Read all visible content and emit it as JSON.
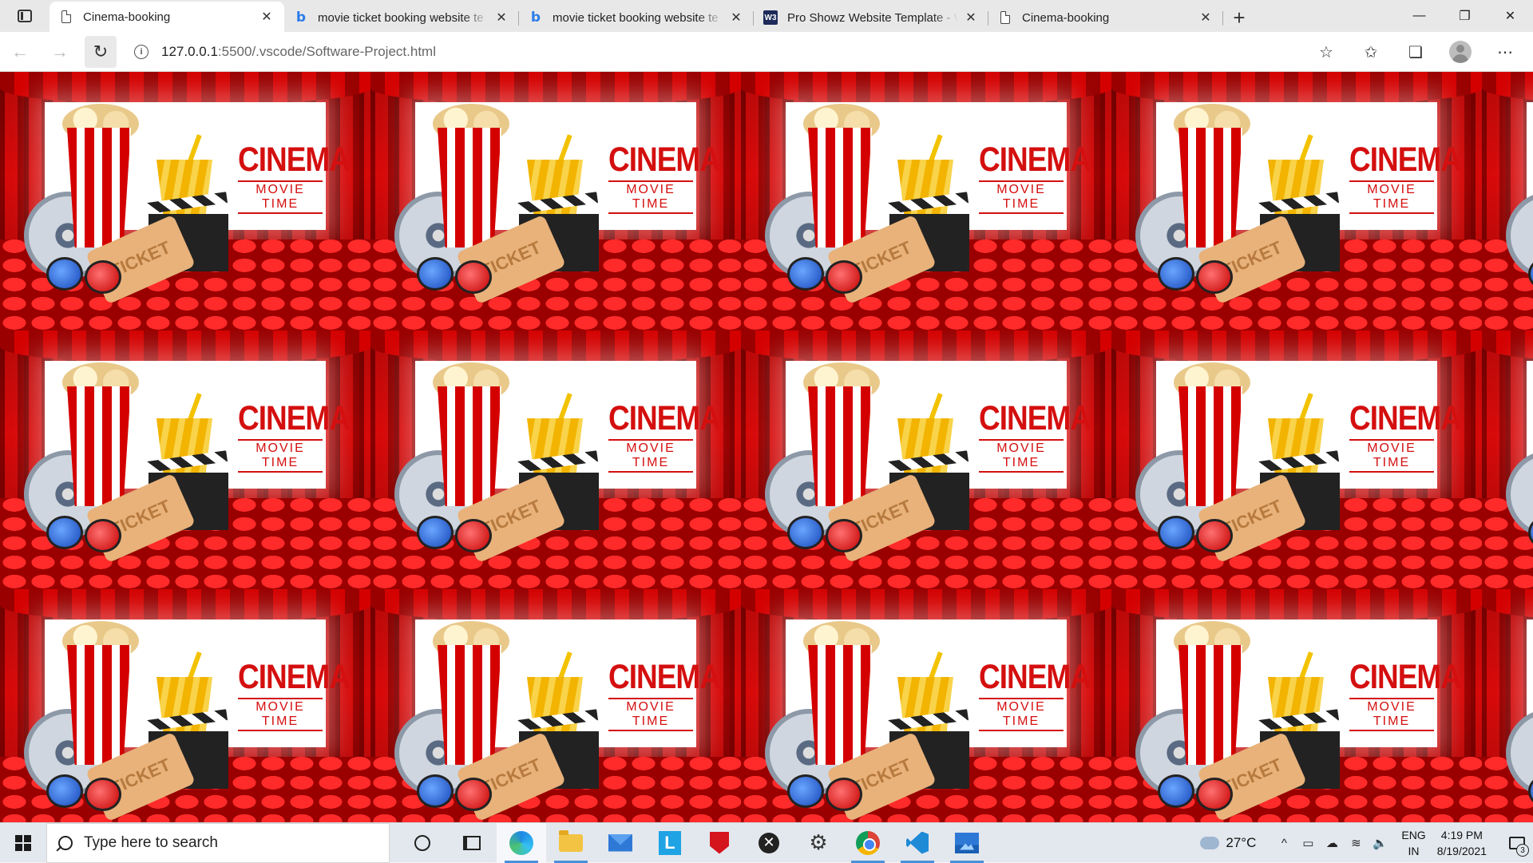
{
  "browser": {
    "tabs": [
      {
        "title": "Cinema-booking",
        "icon": "document-icon",
        "active": true
      },
      {
        "title": "movie ticket booking website te",
        "icon": "bing-icon",
        "active": false
      },
      {
        "title": "movie ticket booking website te",
        "icon": "bing-icon",
        "active": false
      },
      {
        "title": "Pro Showz Website Template - W",
        "icon": "w3-icon",
        "active": false
      },
      {
        "title": "Cinema-booking",
        "icon": "document-icon",
        "active": false
      }
    ],
    "close_glyph": "✕",
    "new_tab_glyph": "+",
    "window_controls": {
      "minimize": "—",
      "restore": "❐",
      "close": "✕"
    },
    "nav": {
      "back": "←",
      "forward": "→",
      "refresh": "↻"
    },
    "url": {
      "host": "127.0.0.1",
      "path": ":5500/.vscode/Software-Project.html"
    },
    "toolbar_icons": {
      "add_favorite": "☆",
      "favorites": "✩",
      "collections": "❏",
      "more": "⋯"
    }
  },
  "page": {
    "banner": {
      "title": "CINEMA",
      "subtitle": "MOVIE TIME",
      "ticket_text": "TICKET"
    },
    "tile_count": 15
  },
  "taskbar": {
    "search_placeholder": "Type here to search",
    "apps": [
      "cortana",
      "task-view",
      "edge",
      "file-explorer",
      "mail",
      "l-app",
      "mcafee",
      "xbox",
      "settings",
      "chrome",
      "vscode",
      "photos"
    ],
    "weather": "27°C",
    "language": {
      "line1": "ENG",
      "line2": "IN"
    },
    "time": "4:19 PM",
    "date": "8/19/2021",
    "notification_count": "3",
    "tray_glyphs": {
      "chevron": "^",
      "meet": "▭",
      "network": "☁",
      "wifi": "≋",
      "volume": "🔈"
    }
  },
  "colors": {
    "banner_red": "#d40f0f",
    "taskbar_bg": "#e3e8ee",
    "active_indicator": "#4a90d9"
  }
}
